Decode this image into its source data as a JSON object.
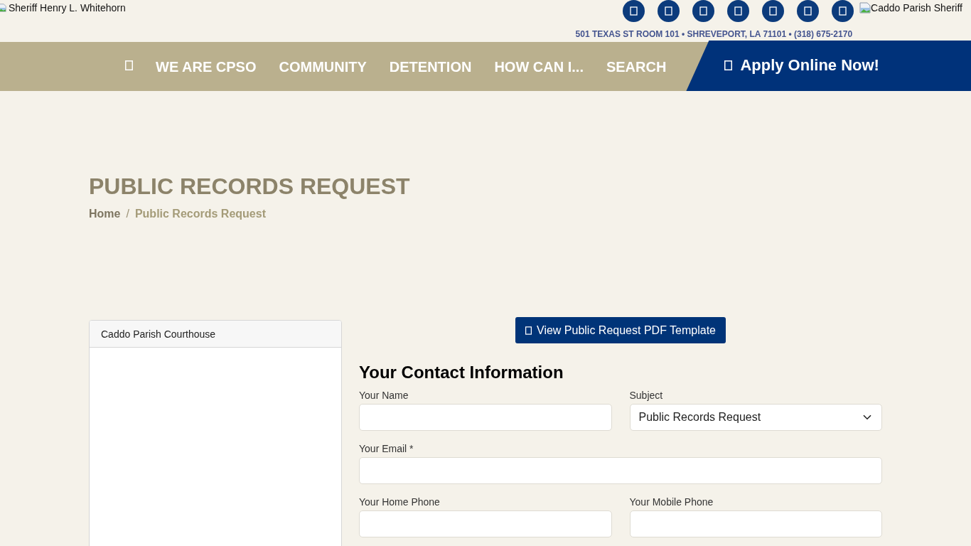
{
  "header": {
    "logo_alt": "Sheriff Henry L. Whitehorn",
    "address": "501 TEXAS ST ROOM 101 • SHREVEPORT, LA 71101 • (318) 675-2170",
    "badge_alt": "Caddo Parish Sheriff"
  },
  "nav": {
    "items": [
      {
        "kind": "icon"
      },
      {
        "kind": "link",
        "label": "WE ARE CPSO"
      },
      {
        "kind": "link",
        "label": "COMMUNITY"
      },
      {
        "kind": "link",
        "label": "DETENTION"
      },
      {
        "kind": "link",
        "label": "HOW CAN I..."
      },
      {
        "kind": "link",
        "label": "SEARCH"
      }
    ],
    "apply_button": "Apply Online Now!"
  },
  "hero": {
    "title": "PUBLIC RECORDS REQUEST",
    "breadcrumb": {
      "items": [
        "Home",
        "Public Records Request"
      ],
      "separator": "/"
    }
  },
  "location_card": {
    "title": "Caddo Parish Courthouse"
  },
  "pdf_button": "View Public Request PDF Template",
  "form": {
    "heading": "Your Contact Information",
    "rows": [
      {
        "fields": [
          {
            "label": "Your Name",
            "kind": "text"
          },
          {
            "label": "Subject",
            "kind": "select",
            "value": "Public Records Request"
          }
        ]
      },
      {
        "fields": [
          {
            "label": "Your Email *",
            "kind": "text"
          }
        ]
      },
      {
        "fields": [
          {
            "label": "Your Home Phone",
            "kind": "text"
          },
          {
            "label": "Your Mobile Phone",
            "kind": "text"
          }
        ]
      }
    ]
  }
}
